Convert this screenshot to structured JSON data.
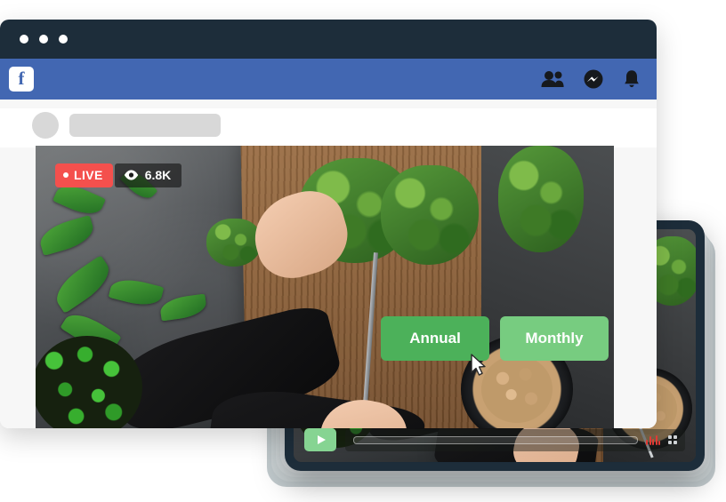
{
  "browser": {
    "window_dots": [
      "dot-1",
      "dot-2",
      "dot-3"
    ],
    "facebook": {
      "logo_letter": "f",
      "logo_name": "facebook-logo",
      "icons": [
        {
          "name": "friends-icon",
          "label": "Friends"
        },
        {
          "name": "messenger-icon",
          "label": "Messenger"
        },
        {
          "name": "notifications-bell-icon",
          "label": "Notifications"
        }
      ]
    },
    "post": {
      "avatar_placeholder": "",
      "name_placeholder": ""
    },
    "video": {
      "live_badge": "LIVE",
      "view_count": "6.8K",
      "eye_icon": "eye-icon"
    }
  },
  "tablet": {
    "plans": [
      {
        "label": "Annual",
        "selected": true
      },
      {
        "label": "Monthly",
        "selected": false
      }
    ],
    "cursor": "mouse-pointer",
    "controls": {
      "play_label": "Play",
      "progress_percent": 0,
      "volume_icon": "equalizer-icon",
      "fullscreen_icon": "fullscreen-icon"
    }
  },
  "colors": {
    "titlebar": "#1d2d3a",
    "facebook_blue": "#4267b2",
    "live_red": "#f4504d",
    "plan_selected_green": "#4cb15a",
    "plan_alt_green": "#77cc80",
    "play_green": "#86d492",
    "eq_red": "#e03a34"
  }
}
